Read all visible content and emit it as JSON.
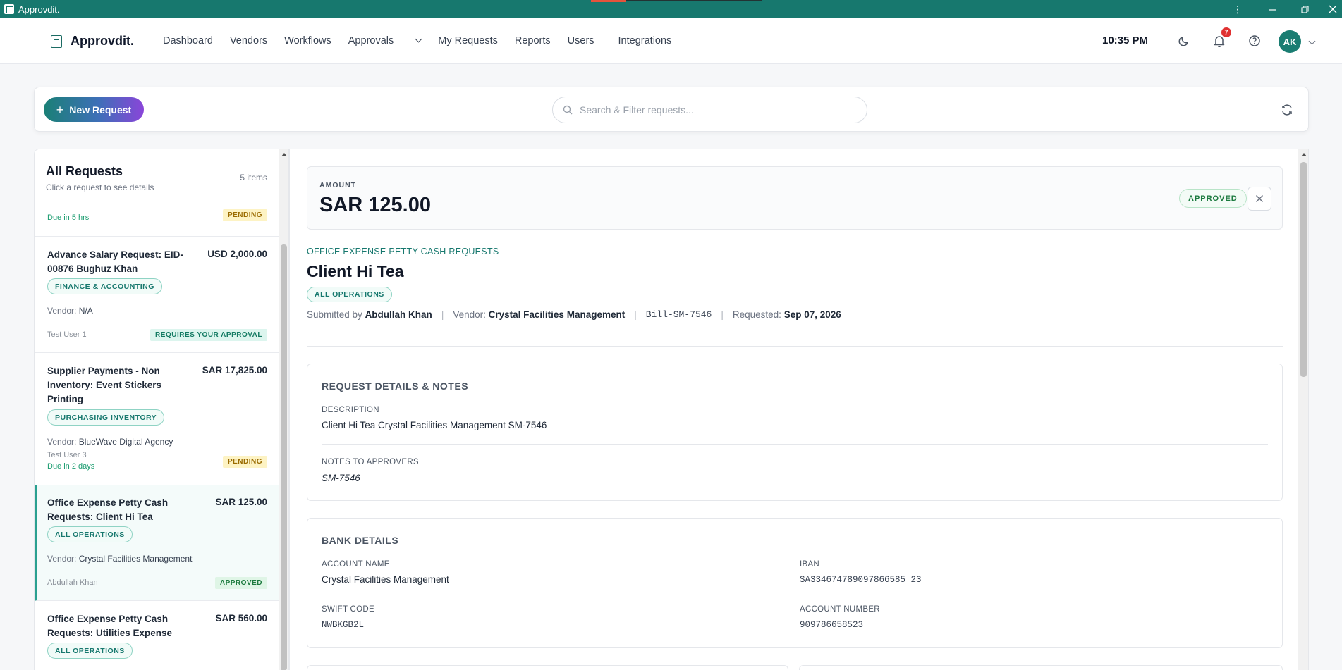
{
  "os": {
    "title": "Approvdit.",
    "menu_icon": "kebab-icon",
    "minimize_icon": "minimize-icon",
    "maximize_icon": "restore-icon",
    "close_icon": "close-icon"
  },
  "nav": {
    "brand": "Approvdit.",
    "links": [
      "Dashboard",
      "Vendors",
      "Workflows",
      "Approvals",
      "My Requests",
      "Reports",
      "Users",
      "Integrations"
    ],
    "time": "10:35 PM",
    "notification_count": "7",
    "avatar_initials": "AK"
  },
  "actions": {
    "new_request": "New Request",
    "search_placeholder": "Search & Filter requests..."
  },
  "list": {
    "title": "All Requests",
    "subtitle": "Click a request to see details",
    "count": "5 items",
    "partial": {
      "due": "Due in 5 hrs",
      "status": "PENDING"
    },
    "items": [
      {
        "title": "Advance Salary Request: EID-00876 Bughuz Khan",
        "amount": "USD 2,000.00",
        "tag": "FINANCE & ACCOUNTING",
        "vendor_label": "Vendor:",
        "vendor": "N/A",
        "user": "Test User 1",
        "due": "",
        "status": "REQUIRES YOUR APPROVAL"
      },
      {
        "title": "Supplier Payments - Non Inventory: Event Stickers Printing",
        "amount": "SAR 17,825.00",
        "tag": "PURCHASING INVENTORY",
        "vendor_label": "Vendor:",
        "vendor": "BlueWave Digital Agency",
        "user": "Test User 3",
        "due": "Due in 2 days",
        "status": "PENDING"
      },
      {
        "title": "Office Expense Petty Cash Requests: Client Hi Tea",
        "amount": "SAR 125.00",
        "tag": "ALL OPERATIONS",
        "vendor_label": "Vendor:",
        "vendor": "Crystal Facilities Management",
        "user": "Abdullah Khan",
        "due": "",
        "status": "APPROVED"
      },
      {
        "title": "Office Expense Petty Cash Requests: Utilities Expense",
        "amount": "SAR 560.00",
        "tag": "ALL OPERATIONS"
      }
    ]
  },
  "detail": {
    "amount_label": "AMOUNT",
    "amount": "SAR 125.00",
    "status": "APPROVED",
    "category": "OFFICE EXPENSE PETTY CASH REQUESTS",
    "title": "Client Hi Tea",
    "tag": "ALL OPERATIONS",
    "submitted_label": "Submitted by",
    "submitted_by": "Abdullah Khan",
    "vendor_label": "Vendor:",
    "vendor": "Crystal Facilities Management",
    "bill": "Bill-SM-7546",
    "requested_label": "Requested:",
    "requested": "Sep 07, 2026",
    "notes_card": {
      "title": "REQUEST DETAILS & NOTES",
      "desc_label": "DESCRIPTION",
      "desc": "Client Hi Tea Crystal Facilities Management SM-7546",
      "notes_label": "NOTES TO APPROVERS",
      "notes": "SM-7546"
    },
    "bank_card": {
      "title": "BANK DETAILS",
      "account_name_label": "ACCOUNT NAME",
      "account_name": "Crystal Facilities Management",
      "iban_label": "IBAN",
      "iban": "SA334674789097866585 23",
      "swift_label": "SWIFT CODE",
      "swift": "NWBKGB2L",
      "account_number_label": "ACCOUNT NUMBER",
      "account_number": "909786658523"
    }
  }
}
